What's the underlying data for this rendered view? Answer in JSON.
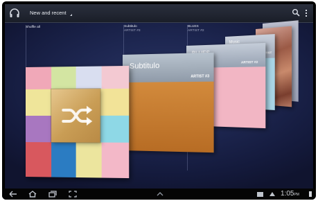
{
  "header": {
    "view_selector_label": "New and recent"
  },
  "cards": [
    {
      "title": "Shuffle all",
      "subtitle": ""
    },
    {
      "title": "Subtitulo",
      "subtitle": "ARTIST #3",
      "cover_title": "Subtitulo",
      "cover_artist": "ARTIST #3"
    },
    {
      "title": "BLUES",
      "subtitle": "ARTIST #2",
      "cover_title": "BLUES",
      "cover_artist": "ARTIST #2"
    },
    {
      "title": "",
      "subtitle": "",
      "cover_title": "Music",
      "cover_artist": "ARTIST"
    }
  ],
  "status_bar": {
    "time": "1:05",
    "ampm": "PM"
  },
  "icons": {
    "app": "headphones-icon",
    "search": "search-icon",
    "menu": "overflow-menu-icon",
    "shuffle": "shuffle-icon",
    "back": "back-icon",
    "home": "home-icon",
    "recent": "recent-apps-icon",
    "screenshot": "screenshot-icon",
    "up": "chevron-up-icon",
    "notification": "notification-icon",
    "battery": "battery-icon",
    "signal": "signal-icon"
  },
  "colors": {
    "background": "#1d2650",
    "actionbar": "#1f2330",
    "orange_cover": "#c97a30",
    "pink_cover": "#f2b6c4",
    "blue_cover": "#a9d5e6"
  }
}
